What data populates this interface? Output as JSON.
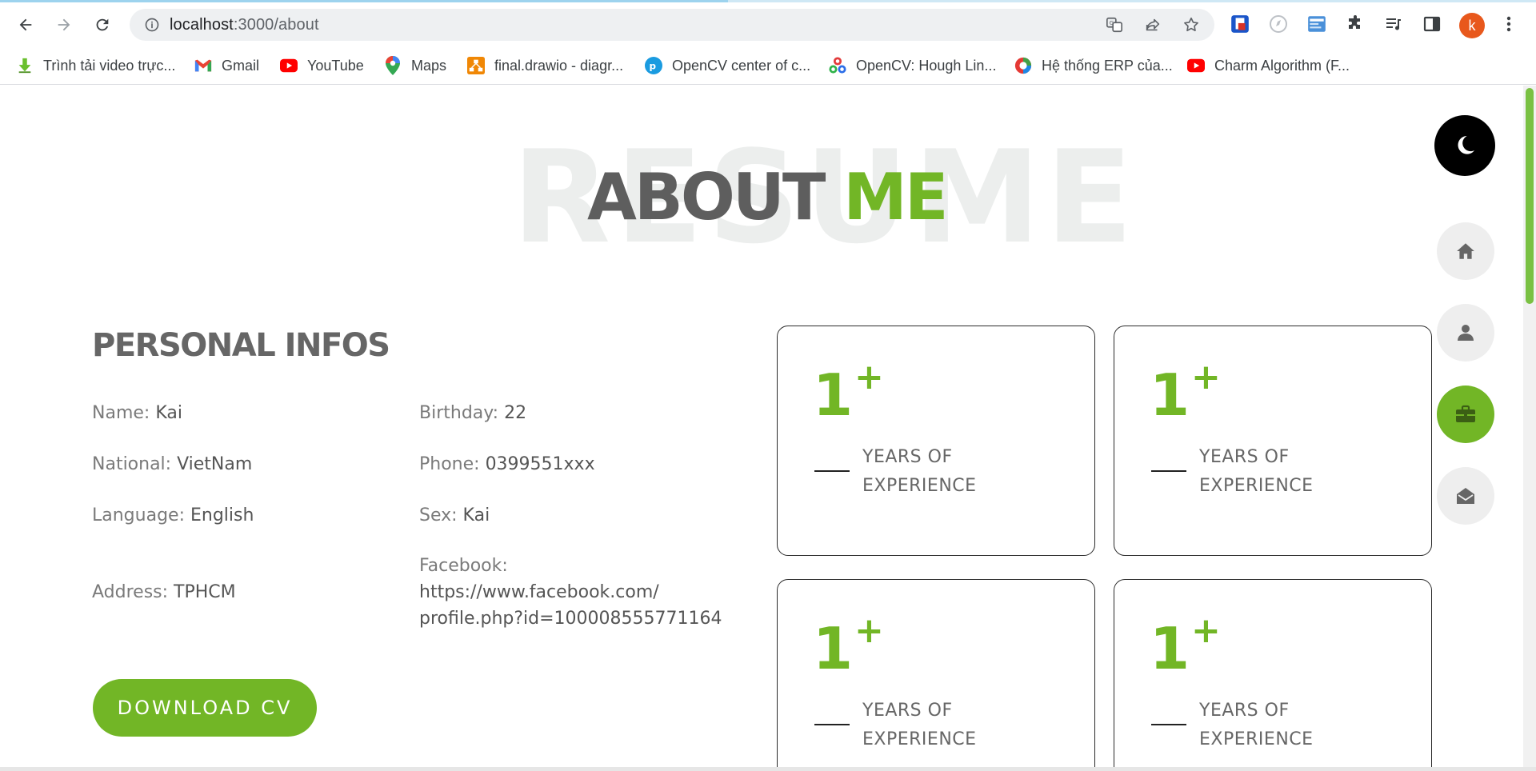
{
  "browser": {
    "url_host": "localhost",
    "url_path": ":3000/about",
    "profile_initial": "k",
    "bookmarks": [
      {
        "label": "Trình tải video trực...",
        "icon": "download-arrow-icon"
      },
      {
        "label": "Gmail",
        "icon": "gmail-icon"
      },
      {
        "label": "YouTube",
        "icon": "youtube-icon"
      },
      {
        "label": "Maps",
        "icon": "maps-pin-icon"
      },
      {
        "label": "final.drawio - diagr...",
        "icon": "drawio-icon"
      },
      {
        "label": "OpenCV center of c...",
        "icon": "pyimage-icon"
      },
      {
        "label": "OpenCV: Hough Lin...",
        "icon": "opencv-icon"
      },
      {
        "label": "Hệ thống ERP của...",
        "icon": "erp-icon"
      },
      {
        "label": "Charm Algorithm (F...",
        "icon": "youtube-icon"
      }
    ]
  },
  "page": {
    "background_word": "RESUME",
    "heading_word1": "ABOUT",
    "heading_word2": "ME",
    "section_title": "PERSONAL INFOS",
    "info": {
      "name_label": "Name:",
      "name_value": "Kai",
      "birthday_label": "Birthday:",
      "birthday_value": "22",
      "national_label": "National:",
      "national_value": "VietNam",
      "phone_label": "Phone:",
      "phone_value": "0399551xxx",
      "language_label": "Language:",
      "language_value": "English",
      "sex_label": "Sex:",
      "sex_value": "Kai",
      "address_label": "Address:",
      "address_value": "TPHCM",
      "facebook_label": "Facebook:",
      "facebook_value_line1": "https://www.facebook.com/",
      "facebook_value_line2": "profile.php?id=100008555771164"
    },
    "download_label": "DOWNLOAD CV",
    "stats": [
      {
        "number": "1",
        "plus": "+",
        "label_line1": "YEARS OF",
        "label_line2": "EXPERIENCE"
      },
      {
        "number": "1",
        "plus": "+",
        "label_line1": "YEARS OF",
        "label_line2": "EXPERIENCE"
      },
      {
        "number": "1",
        "plus": "+",
        "label_line1": "YEARS OF",
        "label_line2": "EXPERIENCE"
      },
      {
        "number": "1",
        "plus": "+",
        "label_line1": "YEARS OF",
        "label_line2": "EXPERIENCE"
      }
    ],
    "side_nav": [
      {
        "icon": "home-icon",
        "active": false
      },
      {
        "icon": "user-icon",
        "active": false
      },
      {
        "icon": "briefcase-icon",
        "active": true
      },
      {
        "icon": "envelope-open-icon",
        "active": false
      }
    ],
    "colors": {
      "accent": "#72b626",
      "heading_dark": "#5e5e5e",
      "text": "#7a7a7a"
    }
  }
}
